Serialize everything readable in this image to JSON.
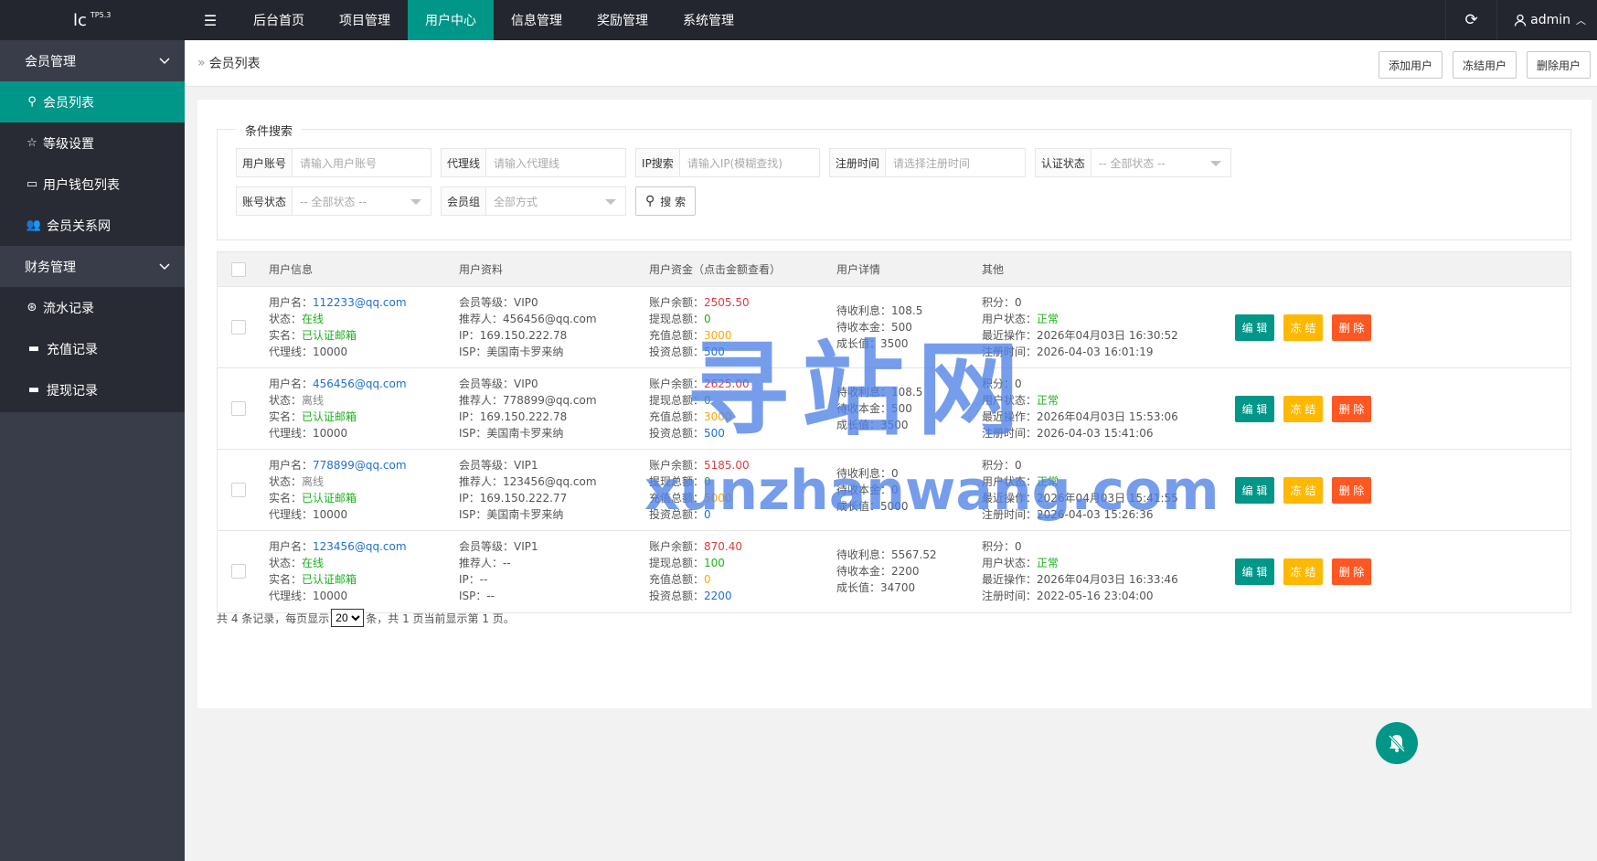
{
  "logo": {
    "text": "lc",
    "sup": "TP5.3"
  },
  "topnav": {
    "toggle_icon": "menu-icon",
    "items": [
      {
        "label": "后台首页",
        "active": false
      },
      {
        "label": "项目管理",
        "active": false
      },
      {
        "label": "用户中心",
        "active": true
      },
      {
        "label": "信息管理",
        "active": false
      },
      {
        "label": "奖励管理",
        "active": false
      },
      {
        "label": "系统管理",
        "active": false
      }
    ],
    "user": "admin"
  },
  "sidebar": {
    "group1": "会员管理",
    "items1": [
      {
        "label": "会员列表",
        "icon": "user-icon",
        "active": true
      },
      {
        "label": "等级设置",
        "icon": "star-icon",
        "active": false
      },
      {
        "label": "用户钱包列表",
        "icon": "card-icon",
        "active": false
      },
      {
        "label": "会员关系网",
        "icon": "group-icon",
        "active": false
      }
    ],
    "group2": "财务管理",
    "items2": [
      {
        "label": "流水记录",
        "icon": "yen-icon"
      },
      {
        "label": "充值记录",
        "icon": "recharge-icon"
      },
      {
        "label": "提现记录",
        "icon": "withdraw-icon"
      }
    ]
  },
  "page": {
    "title": "会员列表",
    "btn_add": "添加用户",
    "btn_freeze": "冻结用户",
    "btn_delete": "删除用户"
  },
  "search": {
    "legend": "条件搜索",
    "account_label": "用户账号",
    "account_placeholder": "请输入用户账号",
    "agent_label": "代理线",
    "agent_placeholder": "请输入代理线",
    "ip_label": "IP搜索",
    "ip_placeholder": "请输入IP(模糊查找)",
    "regtime_label": "注册时间",
    "regtime_placeholder": "请选择注册时间",
    "verify_label": "认证状态",
    "verify_value": "-- 全部状态 --",
    "acct_status_label": "账号状态",
    "acct_status_value": "-- 全部状态 --",
    "group_label": "会员组",
    "group_value": "全部方式",
    "search_btn": "搜 索"
  },
  "table": {
    "headers": [
      "用户信息",
      "用户资料",
      "用户资金（点击金额查看）",
      "用户详情",
      "其他"
    ],
    "labels": {
      "username": "用户名：",
      "status": "状态：",
      "realname": "实名：",
      "agent": "代理线：",
      "level": "会员等级：",
      "referrer": "推荐人：",
      "ip": "IP：",
      "isp": "ISP：",
      "balance": "账户余额：",
      "withdraw": "提现总额：",
      "recharge": "充值总额：",
      "invest": "投资总额：",
      "interest": "待收利息：",
      "principal": "待收本金：",
      "growth": "成长值：",
      "points": "积分：",
      "userstatus": "用户状态：",
      "lastop": "最近操作：",
      "regtime": "注册时间："
    },
    "rows": [
      {
        "username": "112233@qq.com",
        "status": "在线",
        "online": true,
        "realname": "已认证邮箱",
        "agent": "10000",
        "level": "VIP0",
        "referrer": "456456@qq.com",
        "ip": "169.150.222.78",
        "isp": "美国南卡罗来纳",
        "balance": "2505.50",
        "withdraw": "0",
        "recharge": "3000",
        "invest": "500",
        "interest": "108.5",
        "principal": "500",
        "growth": "3500",
        "points": "0",
        "userstatus": "正常",
        "lastop": "2026年04月03日 16:30:52",
        "regtime": "2026-04-03 16:01:19"
      },
      {
        "username": "456456@qq.com",
        "status": "离线",
        "online": false,
        "realname": "已认证邮箱",
        "agent": "10000",
        "level": "VIP0",
        "referrer": "778899@qq.com",
        "ip": "169.150.222.78",
        "isp": "美国南卡罗来纳",
        "balance": "2625.00",
        "withdraw": "0",
        "recharge": "3000",
        "invest": "500",
        "interest": "108.5",
        "principal": "500",
        "growth": "3500",
        "points": "0",
        "userstatus": "正常",
        "lastop": "2026年04月03日 15:53:06",
        "regtime": "2026-04-03 15:41:06"
      },
      {
        "username": "778899@qq.com",
        "status": "离线",
        "online": false,
        "realname": "已认证邮箱",
        "agent": "10000",
        "level": "VIP1",
        "referrer": "123456@qq.com",
        "ip": "169.150.222.77",
        "isp": "美国南卡罗来纳",
        "balance": "5185.00",
        "withdraw": "0",
        "recharge": "5000",
        "invest": "0",
        "interest": "0",
        "principal": "0",
        "growth": "5000",
        "points": "0",
        "userstatus": "正常",
        "lastop": "2026年04月03日 15:41:55",
        "regtime": "2026-04-03 15:26:36"
      },
      {
        "username": "123456@qq.com",
        "status": "在线",
        "online": true,
        "realname": "已认证邮箱",
        "agent": "10000",
        "level": "VIP1",
        "referrer": "--",
        "ip": "--",
        "isp": "--",
        "balance": "870.40",
        "withdraw": "100",
        "recharge": "0",
        "invest": "2200",
        "interest": "5567.52",
        "principal": "2200",
        "growth": "34700",
        "points": "0",
        "userstatus": "正常",
        "lastop": "2026年04月03日 16:33:46",
        "regtime": "2022-05-16 23:04:00"
      }
    ],
    "btn_edit": "编 辑",
    "btn_freeze": "冻 结",
    "btn_delete": "删 除"
  },
  "pager": {
    "prefix": "共 4 条记录，每页显示",
    "per_page": "20",
    "suffix": "条，共 1 页当前显示第 1 页。"
  },
  "watermark": {
    "line1": "寻站网",
    "line2": "xunzhanwang.com"
  },
  "colors": {
    "accent": "#009688",
    "topbar": "#23262e",
    "sidebar": "#393d49",
    "freeze": "#ffb800",
    "delete": "#ff5722"
  }
}
